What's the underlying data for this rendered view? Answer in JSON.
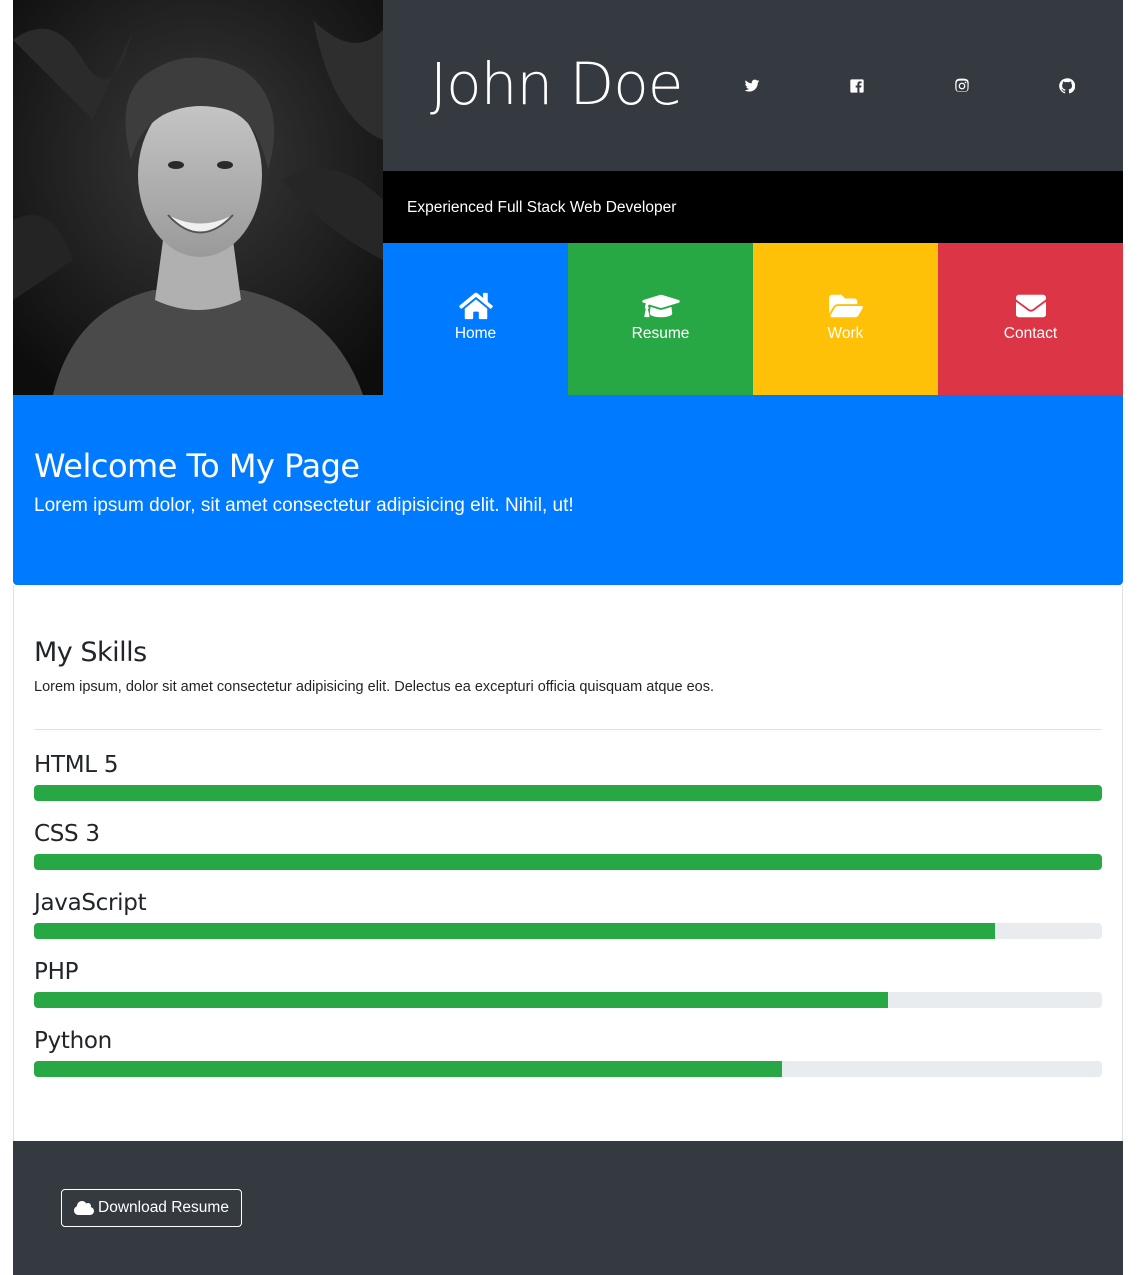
{
  "header": {
    "name": "John Doe",
    "tagline": "Experienced Full Stack Web Developer",
    "social": [
      "twitter-icon",
      "facebook-icon",
      "instagram-icon",
      "github-icon"
    ]
  },
  "nav": {
    "items": [
      {
        "label": "Home",
        "icon": "home-icon",
        "color": "#007bff"
      },
      {
        "label": "Resume",
        "icon": "graduation-cap-icon",
        "color": "#28a745"
      },
      {
        "label": "Work",
        "icon": "folder-open-icon",
        "color": "#ffc107"
      },
      {
        "label": "Contact",
        "icon": "envelope-icon",
        "color": "#dc3545"
      }
    ]
  },
  "welcome": {
    "title": "Welcome To My Page",
    "text": "Lorem ipsum dolor, sit amet consectetur adipisicing elit. Nihil, ut!"
  },
  "skills": {
    "title": "My Skills",
    "intro": "Lorem ipsum, dolor sit amet consectetur adipisicing elit. Delectus ea excepturi officia quisquam atque eos.",
    "items": [
      {
        "name": "HTML 5",
        "level": 100
      },
      {
        "name": "CSS 3",
        "level": 100
      },
      {
        "name": "JavaScript",
        "level": 90
      },
      {
        "name": "PHP",
        "level": 80
      },
      {
        "name": "Python",
        "level": 70
      }
    ]
  },
  "footer": {
    "download_label": "Download Resume",
    "download_icon": "cloud-icon"
  },
  "colors": {
    "dark": "#343a40",
    "primary": "#007bff",
    "success": "#28a745",
    "warning": "#ffc107",
    "danger": "#dc3545"
  }
}
